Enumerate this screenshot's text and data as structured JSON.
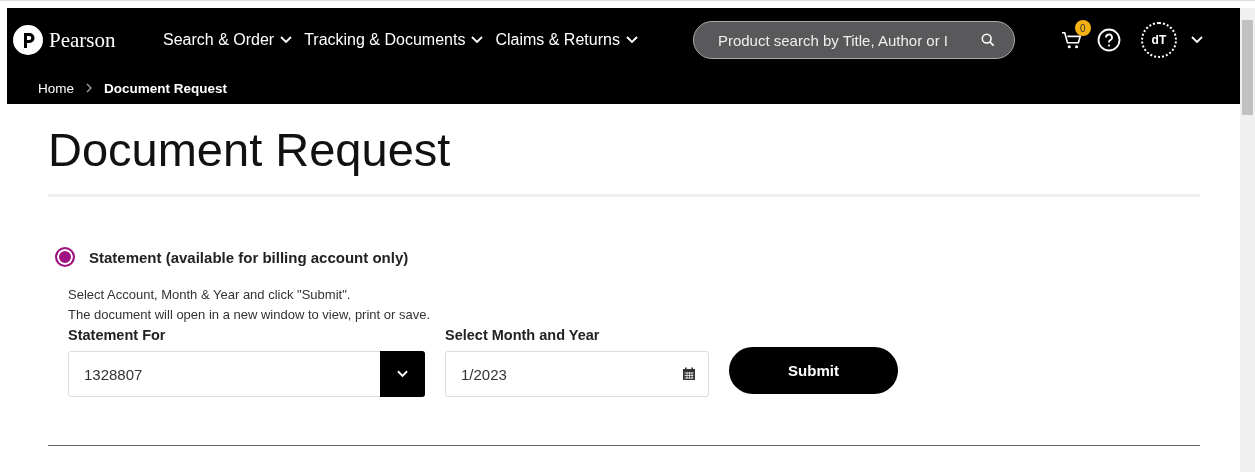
{
  "header": {
    "logo": "Pearson",
    "nav": [
      {
        "label": "Search & Order"
      },
      {
        "label": "Tracking & Documents"
      },
      {
        "label": "Claims & Returns"
      }
    ],
    "search": {
      "placeholder": "Product search by Title, Author or I"
    },
    "cart_count": "0",
    "avatar": "dT"
  },
  "breadcrumb": [
    {
      "label": "Home",
      "current": false
    },
    {
      "label": "Document Request",
      "current": true
    }
  ],
  "title": "Document Request",
  "options": [
    {
      "label": "Statement (available for billing account only)",
      "selected": true
    }
  ],
  "instructions": [
    "Select Account, Month & Year and click \"Submit\".",
    "The document will open in a new window to view, print or save."
  ],
  "fields": [
    {
      "kind": "select",
      "label": "Statement For",
      "value": "1328807"
    },
    {
      "kind": "date",
      "label": "Select Month and Year",
      "value": "1/2023"
    }
  ],
  "submit": "Submit"
}
